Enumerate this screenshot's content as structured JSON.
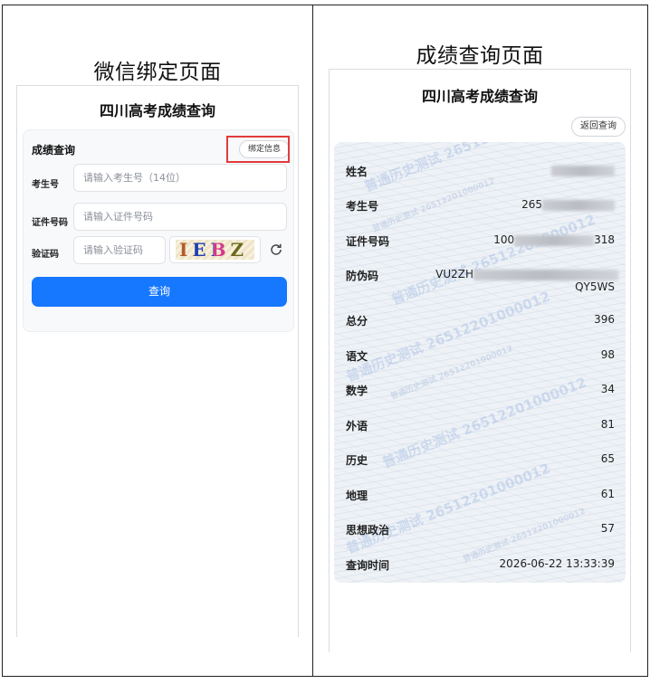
{
  "captions": {
    "left": "微信绑定页面",
    "right": "成绩查询页面"
  },
  "bind_page": {
    "app_title": "四川高考成绩查询",
    "card_title": "成绩查询",
    "bind_button": "绑定信息",
    "fields": {
      "exam_no_label": "考生号",
      "exam_no_placeholder": "请输入考生号（14位）",
      "id_label": "证件号码",
      "id_placeholder": "请输入证件号码",
      "captcha_label": "验证码",
      "captcha_placeholder": "请输入验证码",
      "captcha_text": "IEBZ"
    },
    "query_button": "查询",
    "colors": {
      "accent": "#1677ff",
      "highlight": "#e23b3b"
    },
    "icons": [
      "refresh-icon"
    ]
  },
  "result_page": {
    "app_title": "四川高考成绩查询",
    "back_button": "返回查询",
    "watermark": "普通历史测试 26512201000012",
    "rows": [
      {
        "label": "姓名",
        "value": ""
      },
      {
        "label": "考生号",
        "value": "265"
      },
      {
        "label": "证件号码",
        "value_start": "100",
        "value_end": "318"
      },
      {
        "label": "防伪码",
        "value_start": "VU2ZH",
        "value_line2": "QY5WS"
      },
      {
        "label": "总分",
        "value": "396"
      },
      {
        "label": "语文",
        "value": "98"
      },
      {
        "label": "数学",
        "value": "34"
      },
      {
        "label": "外语",
        "value": "81"
      },
      {
        "label": "历史",
        "value": "65"
      },
      {
        "label": "地理",
        "value": "61"
      },
      {
        "label": "思想政治",
        "value": "57"
      },
      {
        "label": "查询时间",
        "value": "2026-06-22 13:33:39"
      }
    ]
  }
}
